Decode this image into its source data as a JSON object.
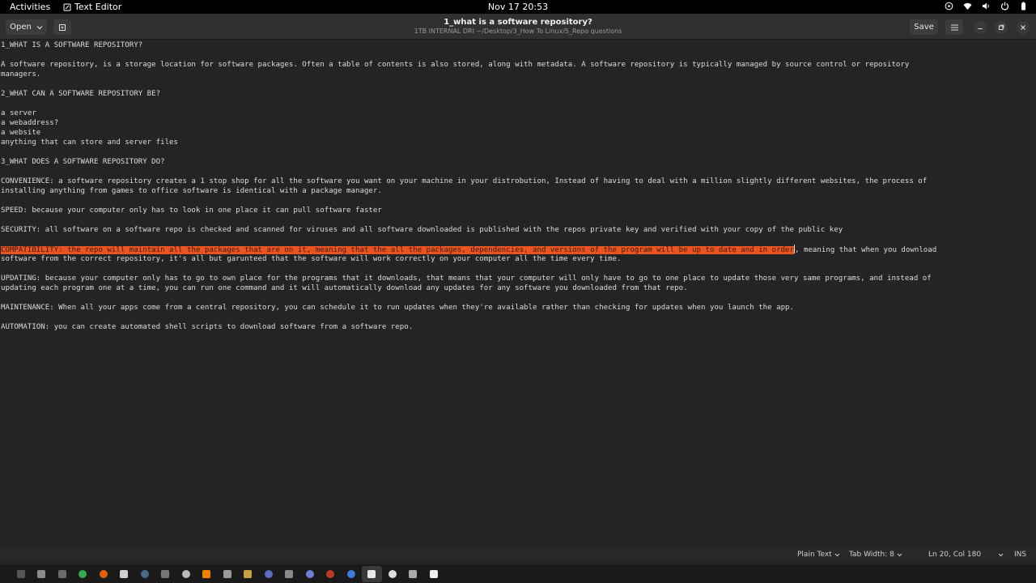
{
  "topbar": {
    "activities": "Activities",
    "app_name": "Text Editor",
    "clock": "Nov 17  20:53"
  },
  "header": {
    "open_label": "Open",
    "title": "1_what is a software repository?",
    "subtitle": "1TB INTERNAL DRI ~/Desktop/3_How To Linux/5_Repo questions",
    "save_label": "Save"
  },
  "editor": {
    "lines": [
      "1_WHAT IS A SOFTWARE REPOSITORY?",
      "",
      "A software repository, is a storage location for software packages. Often a table of contents is also stored, along with metadata. A software repository is typically managed by source control or repository",
      "managers.",
      "",
      "2_WHAT CAN A SOFTWARE REPOSITORY BE?",
      "",
      "a server",
      "a webaddress?",
      "a website",
      "anything that can store and server files",
      "",
      "3_WHAT DOES A SOFTWARE REPOSITORY DO?",
      "",
      "CONVENIENCE: a software repository creates a 1 stop shop for all the software you want on your machine in your distrobution, Instead of having to deal with a million slightly different websites, the process of",
      "installing anything from games to office software is identical with a package manager.",
      "",
      "SPEED: because your computer only has to look in one place it can pull software faster",
      "",
      "SECURITY: all software on a software repo is checked and scanned for viruses and all software downloaded is published with the repos private key and verified with your copy of the public key",
      "",
      "",
      "software from the correct repository, it's all but garunteed that the software will work correctly on your computer all the time every time.",
      "",
      "UPDATING: because your computer only has to go to own place for the programs that it downloads, that means that your computer will only have to go to one place to update those very same programs, and instead of",
      "updating each program one at a time, you can run one command and it will automatically download any updates for any software you downloaded from that repo.",
      "",
      "MAINTENANCE: When all your apps come from a central repository, you can schedule it to run updates when they're available rather than checking for updates when you launch the app.",
      "",
      "AUTOMATION: you can create automated shell scripts to download software from a software repo."
    ],
    "selected_text": "COMPATIBILITY: the repo will maintain all the packages that are on it, meaning that the all the packages, dependencies, and versions of the program will be up to date and in order",
    "after_selection_text": ", meaning that when you download"
  },
  "statusbar": {
    "language": "Plain Text",
    "tab_width": "Tab Width: 8",
    "position": "Ln 20, Col 180",
    "mode": "INS"
  },
  "colors": {
    "selection": "#e95420",
    "background": "#242424",
    "topbar": "#000000"
  }
}
